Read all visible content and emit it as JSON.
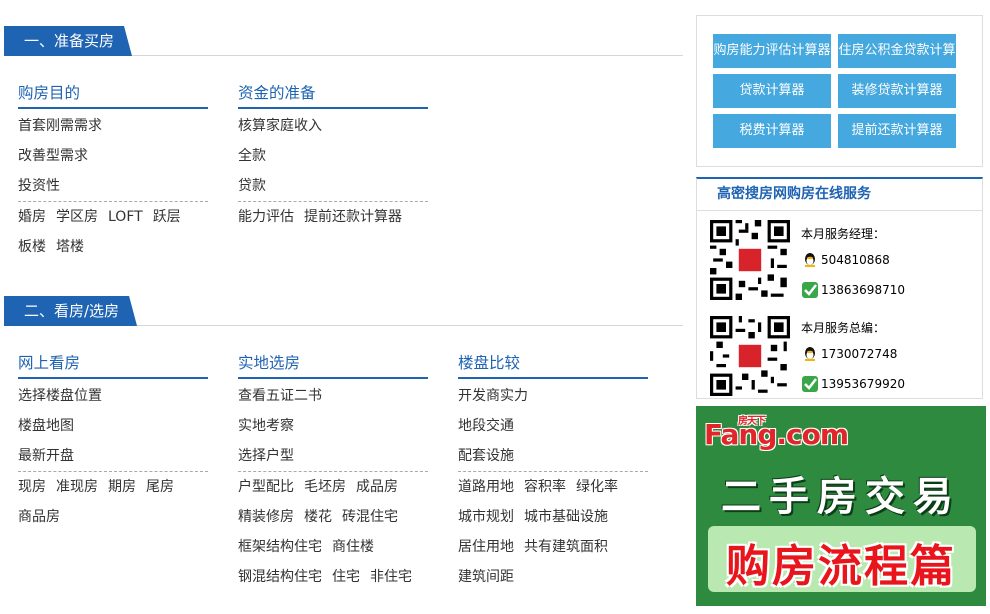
{
  "section1": {
    "title": "一、准备买房",
    "columns": [
      {
        "title": "购房目的",
        "rows": [
          {
            "items": [
              "首套刚需需求"
            ]
          },
          {
            "items": [
              "改善型需求"
            ]
          },
          {
            "items": [
              "投资性"
            ]
          },
          {
            "dash": true,
            "items": [
              "婚房",
              "学区房",
              "LOFT",
              "跃层"
            ]
          },
          {
            "items": [
              "板楼",
              "塔楼"
            ]
          }
        ]
      },
      {
        "title": "资金的准备",
        "rows": [
          {
            "items": [
              "核算家庭收入"
            ]
          },
          {
            "items": [
              "全款"
            ]
          },
          {
            "items": [
              "贷款"
            ]
          },
          {
            "dash": true,
            "items": [
              "能力评估",
              "提前还款计算器"
            ]
          }
        ]
      }
    ]
  },
  "section2": {
    "title": "二、看房/选房",
    "columns": [
      {
        "title": "网上看房",
        "rows": [
          {
            "items": [
              "选择楼盘位置"
            ]
          },
          {
            "items": [
              "楼盘地图"
            ]
          },
          {
            "items": [
              "最新开盘"
            ]
          },
          {
            "dash": true,
            "items": [
              "现房",
              "准现房",
              "期房",
              "尾房"
            ]
          },
          {
            "items": [
              "商品房"
            ]
          }
        ]
      },
      {
        "title": "实地选房",
        "rows": [
          {
            "items": [
              "查看五证二书"
            ]
          },
          {
            "items": [
              "实地考察"
            ]
          },
          {
            "items": [
              "选择户型"
            ]
          },
          {
            "dash": true,
            "items": [
              "户型配比",
              "毛坯房",
              "成品房"
            ]
          },
          {
            "items": [
              "精装修房",
              "楼花",
              "砖混住宅"
            ]
          },
          {
            "items": [
              "框架结构住宅",
              "商住楼"
            ]
          },
          {
            "items": [
              "钢混结构住宅",
              "住宅",
              "非住宅"
            ]
          }
        ]
      },
      {
        "title": "楼盘比较",
        "rows": [
          {
            "items": [
              "开发商实力"
            ]
          },
          {
            "items": [
              "地段交通"
            ]
          },
          {
            "items": [
              "配套设施"
            ]
          },
          {
            "dash": true,
            "items": [
              "道路用地",
              "容积率",
              "绿化率"
            ]
          },
          {
            "items": [
              "城市规划",
              "城市基础设施"
            ]
          },
          {
            "items": [
              "居住用地",
              "共有建筑面积"
            ]
          },
          {
            "items": [
              "建筑间距"
            ]
          }
        ]
      }
    ]
  },
  "calculators": [
    "购房能力评估计算器",
    "住房公积金贷款计算",
    "贷款计算器",
    "装修贷款计算器",
    "税费计算器",
    "提前还款计算器"
  ],
  "service": {
    "title": "高密搜房网购房在线服务",
    "manager_label": "本月服务经理：",
    "manager_qq": "504810868",
    "manager_phone": "13863698710",
    "editor_label": "本月服务总编：",
    "editor_qq": "1730072748",
    "editor_phone": "13953679920"
  },
  "banner": {
    "logo": "Fang.com",
    "logo_small": "房天下",
    "line1": "二手房交易",
    "line2": "购房流程篇"
  },
  "colors": {
    "accent": "#1f63b3",
    "button": "#45a8de",
    "banner_bg": "#2e8a3f"
  }
}
